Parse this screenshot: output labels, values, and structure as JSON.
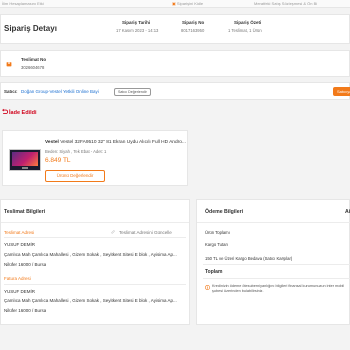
{
  "topbar": {
    "left": "İlim Hesaplamasını Etki",
    "center": "Siparişini Kidle",
    "right": "Meratfeki Satış Sözleşmesi & Ön Bi"
  },
  "order": {
    "title": "Sipariş Detayı",
    "date_label": "Sipariş Tarihi",
    "date_value": "17 Kasım 2023 - 14:13",
    "number_label": "Sipariş No",
    "number_value": "8017163950",
    "summary_label": "Sipariş Özeti",
    "summary_value": "1 Teslimat, 1 Ürün"
  },
  "tracking": {
    "label": "Teslimat No",
    "value": "3026604678"
  },
  "seller": {
    "prefix": "Satıcı:",
    "name": "Doğan Group-Vestel Yetkili Online Bayi",
    "rate_button": "Satıcı Değerlendir",
    "right_button": "Satıcıya"
  },
  "return_status": {
    "label": "İade Edildi"
  },
  "product": {
    "title": "Vestel  32FA9510 32\" 81 Ekran Uydu Alıcılı Full HD Andro...",
    "meta": "Beden: Siyah , Tek Ebat - Adet: 1",
    "price": "6.849 TL",
    "review_button": "Ürünü Değerlendir"
  },
  "delivery": {
    "title": "Teslimat Bilgileri",
    "shipping_address_label": "Teslimat Adresi",
    "update_link": "Teslimat Adresini Güncelle",
    "shipping_name": "YUSUF DEMİR",
    "shipping_line": "Çamlıca Mah Çamlıca Mahallesi , Gizem Sokak , Seyitkent Sitesi E blok , Ayisima Ap...",
    "shipping_city": "Nilüfer 16000 / Bursa",
    "billing_address_label": "Fatura Adresi",
    "billing_name": "YUSUF DEMİR",
    "billing_line": "Çamlıca Mah Çamlıca Mahallesi , Gizem Sokak , Seyitkent Sitesi E blok , Ayisima Ap...",
    "billing_city": "Nilüfer 16000 / Bursa"
  },
  "payment": {
    "title": "Ödeme Bilgileri",
    "right_cut": "Ai",
    "subtotal_label": "Ürün Toplamı",
    "shipping_label": "Kargo Tutarı",
    "free_shipping_label": "150 TL ve Üzeri Kargo Bedava (Satıcı Karşılar)",
    "total_label": "Toplam",
    "notice": "Kredinizin ödeme ötesuberniyanlığını bilgileri finansal kurumunuzun inter mobil şubesi üzerinden bulabilirsiniz."
  },
  "colors": {
    "accent": "#f27a1a",
    "return_red": "#d0021b",
    "seller_blue": "#1b6fd1"
  }
}
